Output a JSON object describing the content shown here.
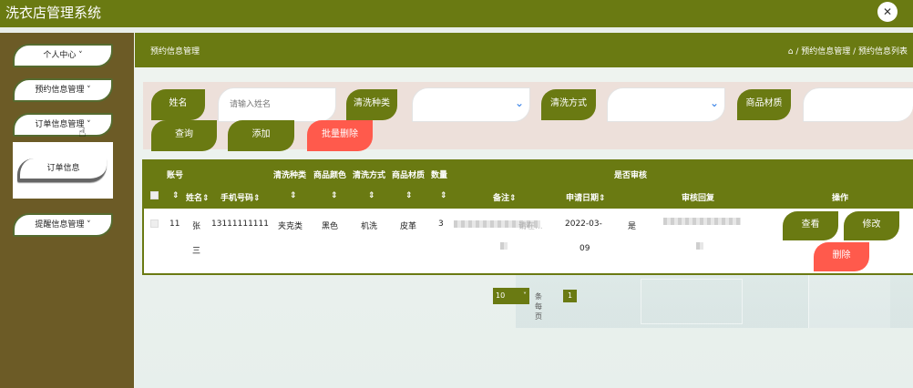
{
  "app": {
    "title": "洗衣店管理系统",
    "fullscreen_icon": "expand-icon"
  },
  "sidebar": {
    "items": [
      {
        "label": "个人中心 ˅"
      },
      {
        "label": "预约信息管理 ˅"
      },
      {
        "label": "订单信息管理 ˅"
      },
      {
        "label": "提醒信息管理 ˅"
      }
    ],
    "submenu": {
      "label": "订单信息"
    }
  },
  "header": {
    "page_title": "预约信息管理",
    "breadcrumb": {
      "home_icon": "⌂",
      "text": "/ 预约信息管理 / 预约信息列表"
    }
  },
  "search": {
    "name_label": "姓名",
    "name_placeholder": "请输入姓名",
    "clean_type_label": "清洗种类",
    "clean_method_label": "清洗方式",
    "material_label": "商品材质",
    "query_button": "查询",
    "add_button": "添加",
    "batch_delete_button": "批量删除"
  },
  "table": {
    "headers_top": {
      "account": "账号",
      "clean_type": "清洗种类",
      "color": "商品颜色",
      "clean_method": "清洗方式",
      "material": "商品材质",
      "quantity": "数量",
      "is_reviewed": "是否审核"
    },
    "headers_bottom": {
      "sort": "⇕",
      "name": "姓名⇕",
      "phone": "手机号码⇕",
      "sort2": "⇕",
      "sort3": "⇕",
      "sort4": "⇕",
      "sort5": "⇕",
      "sort6": "⇕",
      "remark": "备注⇕",
      "apply_date": "申请日期⇕",
      "review_reply": "审核回复",
      "actions": "操作"
    },
    "row": {
      "account": "11",
      "name_line1": "张",
      "name_line2": "三",
      "phone": "13111111111",
      "clean_type": "夹克类",
      "color": "黑色",
      "clean_method": "机洗",
      "material": "皮革",
      "quantity": "3",
      "remark_hint": "请在...",
      "apply_date_line1": "2022-03-",
      "apply_date_line2": "09",
      "is_reviewed": "是",
      "view_button": "查看",
      "edit_button": "修改",
      "delete_button": "删除"
    }
  },
  "pagination": {
    "page_size": "10",
    "per_page_label": "条每页",
    "current_page": "1"
  },
  "colors": {
    "primary": "#6a7a12",
    "sidebar": "#6c5b26",
    "danger": "#ff5a4c",
    "search_bg": "#ede0da"
  }
}
